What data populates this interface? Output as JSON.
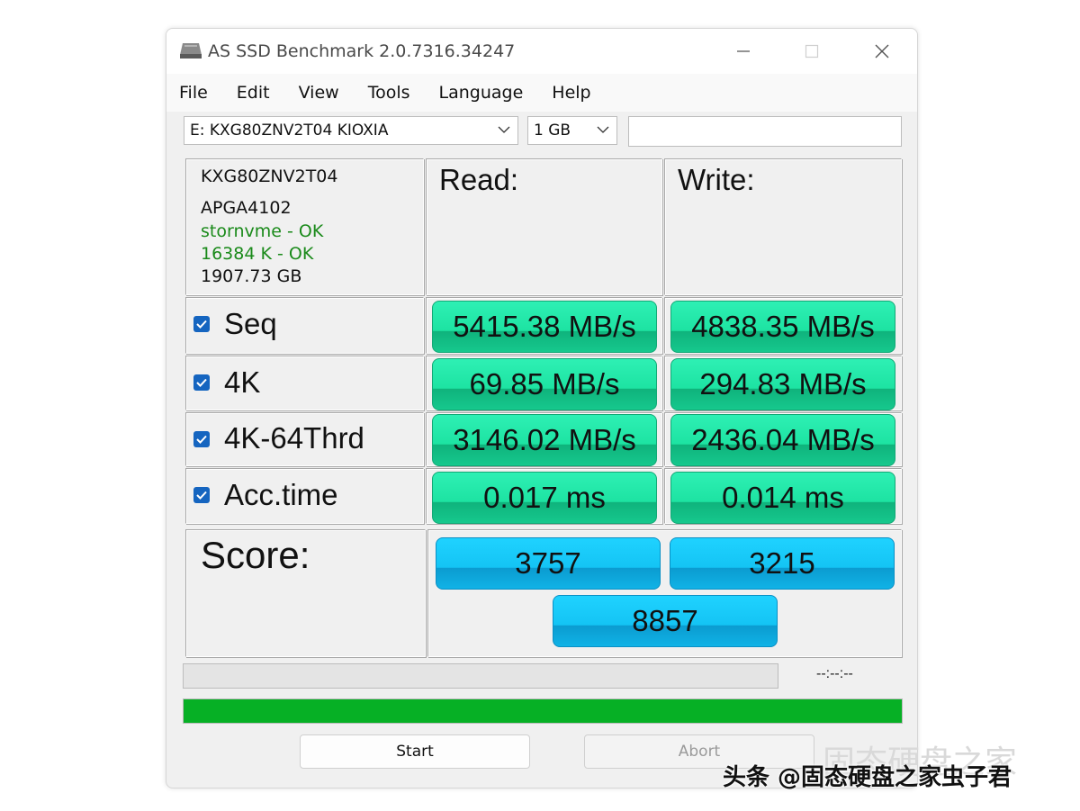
{
  "window": {
    "title": "AS SSD Benchmark 2.0.7316.34247",
    "minimize_icon": "minimize-icon",
    "maximize_icon": "maximize-icon",
    "close_icon": "close-icon"
  },
  "menu": [
    "File",
    "Edit",
    "View",
    "Tools",
    "Language",
    "Help"
  ],
  "toolbar": {
    "drive_select": "E: KXG80ZNV2T04 KIOXIA",
    "size_select": "1 GB",
    "text_field": ""
  },
  "drive_info": {
    "model": "KXG80ZNV2T04",
    "firmware": "APGA4102",
    "driver_status": "stornvme - OK",
    "alignment_status": "16384 K - OK",
    "capacity": "1907.73 GB",
    "ok_color": "#1a8a1a"
  },
  "columns": {
    "read": "Read:",
    "write": "Write:"
  },
  "tests": [
    {
      "label": "Seq",
      "checked": true,
      "read": "5415.38 MB/s",
      "write": "4838.35 MB/s"
    },
    {
      "label": "4K",
      "checked": true,
      "read": "69.85 MB/s",
      "write": "294.83 MB/s"
    },
    {
      "label": "4K-64Thrd",
      "checked": true,
      "read": "3146.02 MB/s",
      "write": "2436.04 MB/s"
    },
    {
      "label": "Acc.time",
      "checked": true,
      "read": "0.017 ms",
      "write": "0.014 ms"
    }
  ],
  "score": {
    "label": "Score:",
    "read": "3757",
    "write": "3215",
    "total": "8857"
  },
  "status": {
    "time": "--:--:--",
    "progress_fraction": 0.0,
    "complete_fraction": 1.0,
    "complete_color": "#06b025"
  },
  "buttons": {
    "start": "Start",
    "abort": "Abort"
  },
  "watermark": {
    "faded": "固态硬盘之家",
    "main": "头条 @固态硬盘之家虫子君"
  }
}
